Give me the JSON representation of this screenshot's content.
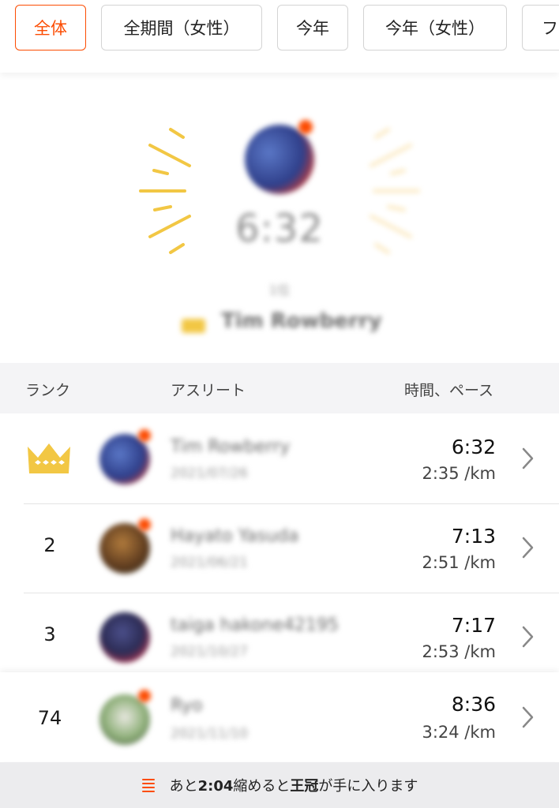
{
  "filters": [
    {
      "label": "全体",
      "active": true
    },
    {
      "label": "全期間（女性）",
      "active": false
    },
    {
      "label": "今年",
      "active": false
    },
    {
      "label": "今年（女性）",
      "active": false
    },
    {
      "label": "フ",
      "active": false
    }
  ],
  "hero": {
    "time": "6:32",
    "sub": "1位",
    "name": "Tim Rowberry"
  },
  "table": {
    "col_rank": "ランク",
    "col_athlete": "アスリート",
    "col_time": "時間、ペース"
  },
  "rows": [
    {
      "rank": "",
      "crown": true,
      "name": "Tim Rowberry",
      "date": "2021/07/26",
      "time": "6:32",
      "pace": "2:35 /km"
    },
    {
      "rank": "2",
      "crown": false,
      "name": "Hayato Yasuda",
      "date": "2021/06/21",
      "time": "7:13",
      "pace": "2:51 /km"
    },
    {
      "rank": "3",
      "crown": false,
      "name": "taiga hakone42195",
      "date": "2021/10/27",
      "time": "7:17",
      "pace": "2:53 /km"
    },
    {
      "rank": "74",
      "crown": false,
      "name": "Ryo",
      "date": "2021/11/10",
      "time": "8:36",
      "pace": "3:24 /km"
    }
  ],
  "footer": {
    "pre": "あと",
    "diff": "2:04",
    "mid": "縮めると",
    "crown_word": "王冠",
    "post": "が手に入ります"
  },
  "colors": {
    "accent": "#fc4c02",
    "crown": "#f2c744"
  }
}
